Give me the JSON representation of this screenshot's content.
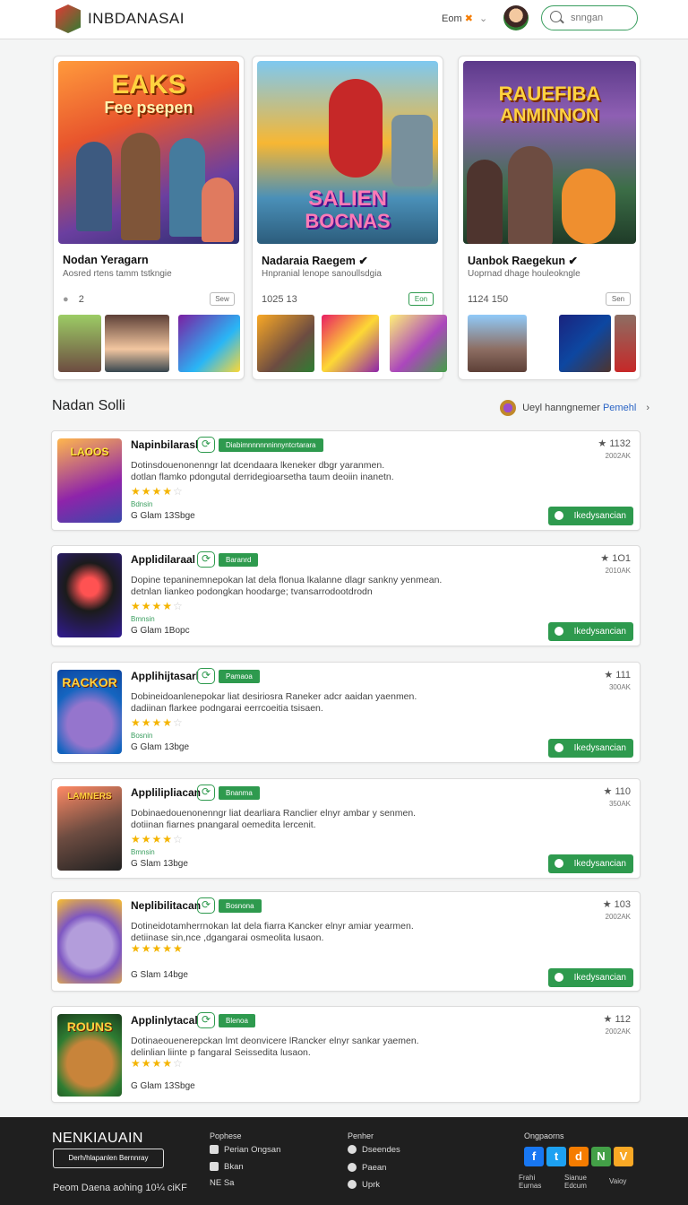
{
  "header": {
    "brand": "INBDANASAI",
    "top_link": "Eom",
    "top_link_glyph": "✖",
    "search_placeholder": "snngan"
  },
  "featured": [
    {
      "art_title": "EAKS",
      "art_subtitle": "Fee psepen",
      "title": "Nodan Yeragarn",
      "subtitle": "Aosred rtens tamm tstkngie",
      "meta": "2",
      "action": "Sew",
      "accent": "#e67e22"
    },
    {
      "art_title": "SALIEN",
      "art_subtitle": "BOCNAS",
      "title": "Nadaraia Raegem",
      "subtitle": "Hnpranial lenope sanoullsdgia",
      "meta": "1025  13",
      "action": "Eon",
      "accent": "#2e9a4e"
    },
    {
      "art_title": "RAUEFIBA",
      "art_subtitle": "ANMINNON",
      "title": "Uanbok Raegekun",
      "subtitle": "Uoprnad dhage houleokngle",
      "meta": "1124  150",
      "action": "Sen",
      "accent": "#888888"
    }
  ],
  "section": {
    "title": "Nadan Solli",
    "link_prefix": "Ueyl hanngnemer",
    "link_emph": "Pemehl"
  },
  "rows": [
    {
      "name": "Napinbilarasl",
      "tag": "Diabimnnnnnninnyntcrtarara",
      "desc_line1": "Dotinsdouenonenngr lat dcendaara lkeneker dbgr yaranmen.",
      "desc_line2": "dotlan flamko pdongutal derridegioarsetha taum deoiin inanetn.",
      "stars": "★★★★",
      "stars_empty": "☆",
      "small": "Bdnsin",
      "foot": "G Glam  13Sbge",
      "num": "1132",
      "num_sub": "2002AK",
      "button": "Ikedysancian",
      "art": "LAOOS"
    },
    {
      "name": "Applidilaraal",
      "tag": "Baranrd",
      "desc_line1": "Dopine tepaninemnepokan lat dela flonua lkalanne dlagr sankny yenmean.",
      "desc_line2": "detnlan liankeo podongkan hoodarge; tvansarrodootdrodn",
      "stars": "★★★★",
      "stars_empty": "☆",
      "small": "Bmnsin",
      "foot": "G Glam  1Bopc",
      "num": "1O1",
      "num_sub": "2010AK",
      "button": "Ikedysancian",
      "art": ""
    },
    {
      "name": "Applihijtasarl",
      "tag": "Pamaoa",
      "desc_line1": "Dobineidoanlenepokar liat desiriosra Raneker adcr aaidan yaenmen.",
      "desc_line2": "dadiinan flarkee podngarai eerrcoeitia tsisaen.",
      "stars": "★★★★",
      "stars_empty": "☆",
      "small": "Bosnin",
      "foot": "G Glam  13bge",
      "num": "111",
      "num_sub": "300AK",
      "button": "Ikedysancian",
      "art": "RACKOR"
    },
    {
      "name": "Applilipliacan",
      "tag": "Bnanma",
      "desc_line1": "Dobinaedouenonenngr liat dearliara Ranclier elnyr ambar y senmen.",
      "desc_line2": "dotiinan fiarnes pnangaral oemedita lercenit.",
      "stars": "★★★★",
      "stars_empty": "☆",
      "small": "Bmnsin",
      "foot": "G Slam  13bge",
      "num": "110",
      "num_sub": "350AK",
      "button": "Ikedysancian",
      "art": "LAMNERS"
    },
    {
      "name": "Neplibilitacan",
      "tag": "Bosnona",
      "desc_line1": "Dotineidotamherrnokan lat dela fiarra Kancker elnyr amiar yearmen.",
      "desc_line2": "detiinase sin,nce ,dgangarai osmeolita lusaon.",
      "stars": "★★★★★",
      "stars_empty": "",
      "small": "",
      "foot": "G Slam  14bge",
      "num": "103",
      "num_sub": "2002AK",
      "button": "Ikedysancian",
      "art": ""
    },
    {
      "name": "Applinlytacal",
      "tag": "Blenoa",
      "desc_line1": "Dotinaeouenerepckan lmt deonvicere lRancker elnyr sankar yaemen.",
      "desc_line2": "delinlian liinte p fangaral Seissedita lusaon.",
      "stars": "★★★★",
      "stars_empty": "☆",
      "small": "",
      "foot": "G Glam  13Sbge",
      "num": "112",
      "num_sub": "2002AK",
      "button": "",
      "art": "ROUNS"
    }
  ],
  "footer": {
    "brand": "NENKIAUAIN",
    "box": "Derh/hlapanlen Bernnray",
    "copyright": "Peom Daena aohing 10¼ ciKF",
    "col1_title": "Pophese",
    "col1_items": [
      "Perian Ongsan",
      "Bkan",
      "NE Sa"
    ],
    "col2_title": "Penher",
    "col2_items": [
      "Dseendes",
      "Paean",
      "Uprk"
    ],
    "col3_title": "Ongpaorns",
    "social": [
      "f",
      "t",
      "d",
      "N",
      "V"
    ],
    "small1": "Frahi Eurnas",
    "small2": "Sianue Edcum",
    "small3": "Vaioy"
  }
}
